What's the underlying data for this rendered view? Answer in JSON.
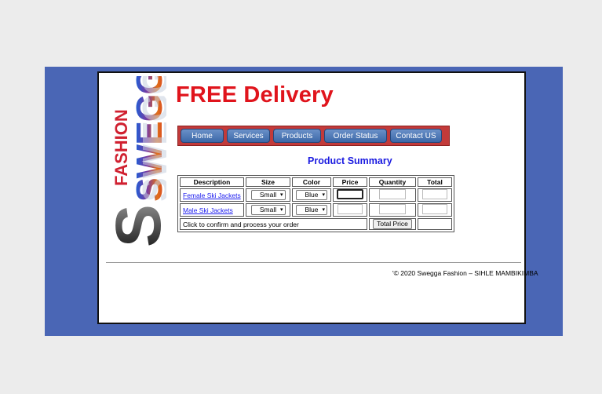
{
  "logo": {
    "word_top": "FASHION",
    "word_main": "SWEGGA",
    "letter": "S"
  },
  "headline": "FREE Delivery",
  "nav": [
    "Home",
    "Services",
    "Products",
    "Order Status",
    "Contact US"
  ],
  "summary_title": "Product Summary",
  "table": {
    "headers": [
      "Description",
      "Size",
      "Color",
      "Price",
      "Quantity",
      "Total"
    ],
    "rows": [
      {
        "description": "Female Ski Jackets",
        "size": "Small",
        "color": "Blue",
        "price": "",
        "quantity": "",
        "total": ""
      },
      {
        "description": "Male Ski Jackets",
        "size": "Small",
        "color": "Blue",
        "price": "",
        "quantity": "",
        "total": ""
      }
    ],
    "confirm_text": "Click to confirm and process your order",
    "total_button": "Total Price"
  },
  "footer": "'© 2020 Swegga Fashion – SIHLE MAMBIKIMBA",
  "colors": {
    "frame": "#4a66b5",
    "headline": "#e0141c",
    "nav_bar": "#c23a3a",
    "nav_button": "#3c68a8",
    "title": "#1a1ae0"
  }
}
